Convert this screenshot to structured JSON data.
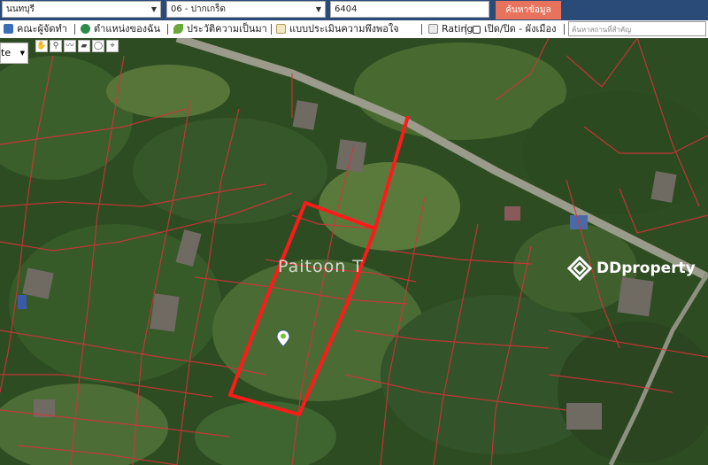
{
  "search": {
    "province": "นนทบุรี",
    "district": "06 - ปากเกร็ด",
    "deed_number": "6404",
    "submit_label": "ค้นหาข้อมูล",
    "place_placeholder": "ค้นหาสถานที่สำคัญ"
  },
  "nav": {
    "items": [
      {
        "label": "คณะผู้จัดทำ",
        "icon": "book-icon"
      },
      {
        "label": "ตำแหน่งของฉัน",
        "icon": "globe-icon"
      },
      {
        "label": "ประวัติความเป็นมา",
        "icon": "sprout-icon"
      },
      {
        "label": "แบบประเมินความพึงพอใจ",
        "icon": "document-icon"
      },
      {
        "label": "Rating",
        "icon": "chart-icon"
      },
      {
        "label": "เปิด/ปิด - ผังเมือง",
        "icon": "checkbox-icon"
      }
    ]
  },
  "map": {
    "layer_label": "te",
    "watermark": "Paitoon T",
    "brand": "DDproperty",
    "marker_icon": "location-pin-icon",
    "colors": {
      "parcel_lines": "#d8323a",
      "highlight": "#ff1a1a",
      "topbar": "#2a4a78",
      "button": "#e8735c"
    }
  }
}
